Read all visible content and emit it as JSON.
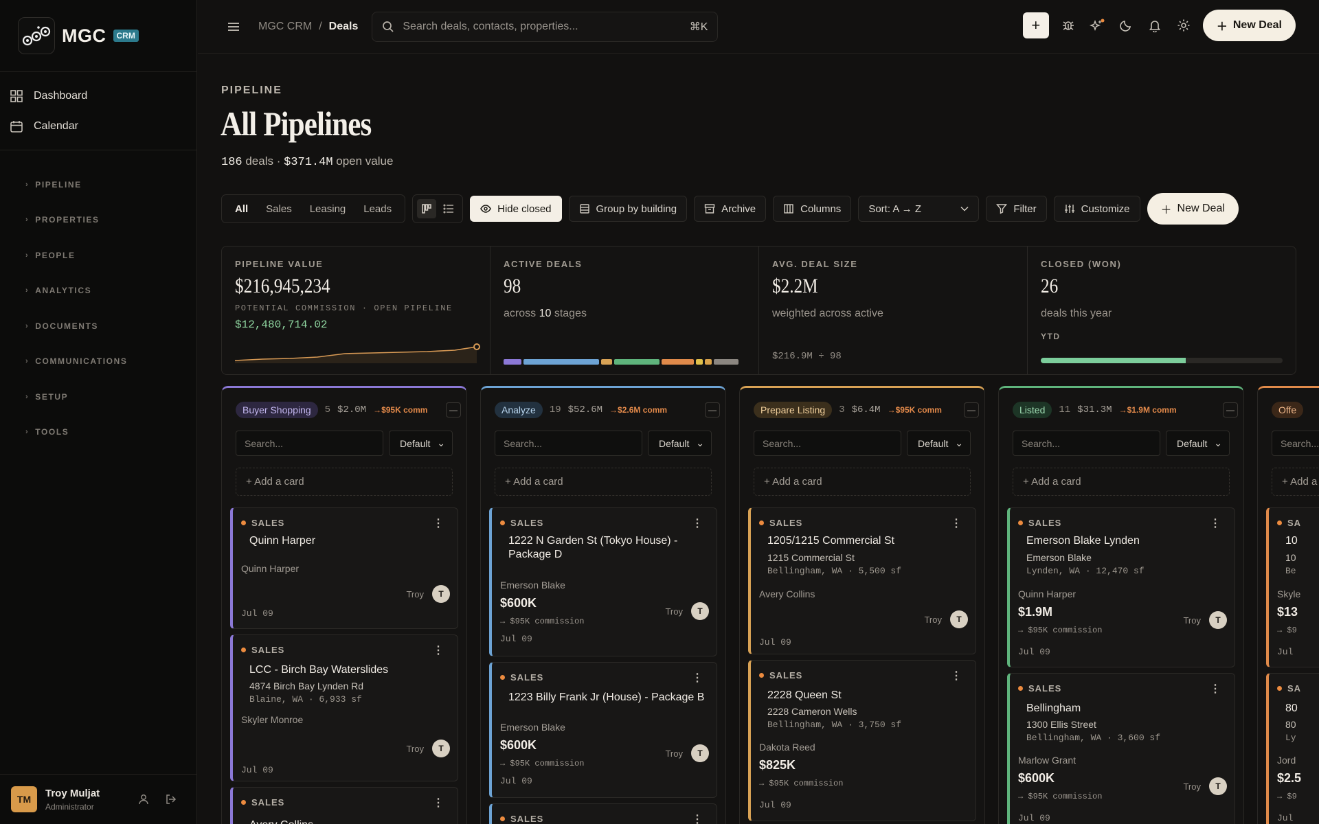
{
  "brand": {
    "name": "MGC",
    "badge": "CRM"
  },
  "sidebar": {
    "main": [
      {
        "label": "Dashboard",
        "icon": "grid-icon"
      },
      {
        "label": "Calendar",
        "icon": "calendar-icon"
      }
    ],
    "sections": [
      "PIPELINE",
      "PROPERTIES",
      "PEOPLE",
      "ANALYTICS",
      "DOCUMENTS",
      "COMMUNICATIONS",
      "SETUP",
      "TOOLS"
    ]
  },
  "user": {
    "initials": "TM",
    "name": "Troy Muljat",
    "role": "Administrator"
  },
  "topbar": {
    "breadcrumb": [
      "MGC CRM",
      "/",
      "Deals"
    ],
    "search_placeholder": "Search deals, contacts, properties...",
    "shortcut": "⌘K",
    "new_deal": "New Deal"
  },
  "page": {
    "kicker": "PIPELINE",
    "title": "All Pipelines",
    "deals_count": "186",
    "deals_label": "deals ·",
    "open_value": "$371.4M",
    "open_label": "open value"
  },
  "toolbar": {
    "tabs": [
      "All",
      "Sales",
      "Leasing",
      "Leads"
    ],
    "hide_closed": "Hide closed",
    "group_by": "Group by building",
    "archive": "Archive",
    "columns": "Columns",
    "sort": "Sort: A → Z",
    "filter": "Filter",
    "customize": "Customize",
    "new_deal": "New Deal"
  },
  "stats": {
    "pipeline": {
      "label": "PIPELINE VALUE",
      "value": "$216,945,234",
      "commission_label": "POTENTIAL COMMISSION · OPEN PIPELINE",
      "commission": "$12,480,714.02"
    },
    "active": {
      "label": "ACTIVE DEALS",
      "value": "98",
      "sub_prefix": "across",
      "stages": "10",
      "sub_suffix": "stages",
      "stage_colors": [
        "#8b78d6",
        "#6da3d4",
        "#d8a255",
        "#5fb47c",
        "#e08a4a",
        "#e0c04a",
        "#d9a24a",
        "#8b8680"
      ],
      "stage_share": [
        0.08,
        0.33,
        0.05,
        0.2,
        0.14,
        0.03,
        0.03,
        0.11
      ]
    },
    "avg": {
      "label": "AVG. DEAL SIZE",
      "value": "$2.2M",
      "sub": "weighted across active",
      "calc": "$216.9M ÷ 98"
    },
    "closed": {
      "label": "CLOSED (WON)",
      "value": "26",
      "sub": "deals this year",
      "ytd_label": "YTD",
      "ytd_fraction": 0.6
    }
  },
  "colors": {
    "accent": "#f5efe3",
    "commission": "#e2894a",
    "positive": "#8fd6a0"
  },
  "columns": [
    {
      "stage": "Buyer Shopping",
      "count": "5",
      "amount": "$2.0M",
      "comm": "→$95K comm",
      "color": "#8b78d6",
      "pill_bg": "#2d2740",
      "pill_fg": "#c4b8f0"
    },
    {
      "stage": "Analyze",
      "count": "19",
      "amount": "$52.6M",
      "comm": "→$2.6M comm",
      "color": "#6da3d4",
      "pill_bg": "#22313f",
      "pill_fg": "#b9d6ef"
    },
    {
      "stage": "Prepare Listing",
      "count": "3",
      "amount": "$6.4M",
      "comm": "→$95K comm",
      "color": "#d8a255",
      "pill_bg": "#3b2f1c",
      "pill_fg": "#f0cf9c"
    },
    {
      "stage": "Listed",
      "count": "11",
      "amount": "$31.3M",
      "comm": "→$1.9M comm",
      "color": "#5fb47c",
      "pill_bg": "#1d3526",
      "pill_fg": "#9fdcb3"
    },
    {
      "stage": "Offe",
      "count": "",
      "amount": "",
      "comm": "",
      "color": "#e08a4a",
      "pill_bg": "#3b2718",
      "pill_fg": "#efb78a"
    }
  ],
  "column_ui": {
    "search_placeholder": "Search...",
    "sort_default": "Default",
    "add_card": "+ Add a card",
    "collapse": "—"
  },
  "cards": {
    "c0": [
      {
        "kind": "SALES",
        "name": "Quinn Harper",
        "contact": "Quinn Harper",
        "owner": "Troy",
        "owner_initial": "T",
        "date": "Jul 09"
      },
      {
        "kind": "SALES",
        "name": "LCC - Birch Bay Waterslides",
        "addr": "4874 Birch Bay Lynden Rd",
        "loc": "Blaine, WA · 6,933 sf",
        "contact": "Skyler Monroe",
        "owner": "Troy",
        "owner_initial": "T",
        "date": "Jul 09"
      },
      {
        "kind": "SALES",
        "name": "Avery Collins"
      }
    ],
    "c1": [
      {
        "kind": "SALES",
        "name": "1222 N Garden St (Tokyo House) - Package D",
        "contact": "Emerson Blake",
        "value": "$600K",
        "comm": "→ $95K commission",
        "owner": "Troy",
        "owner_initial": "T",
        "date": "Jul 09"
      },
      {
        "kind": "SALES",
        "name": "1223 Billy Frank Jr (House) - Package B",
        "contact": "Emerson Blake",
        "value": "$600K",
        "comm": "→ $95K commission",
        "owner": "Troy",
        "owner_initial": "T",
        "date": "Jul 09"
      },
      {
        "kind": "SALES"
      }
    ],
    "c2": [
      {
        "kind": "SALES",
        "name": "1205/1215 Commercial St",
        "addr": "1215 Commercial St",
        "loc": "Bellingham, WA · 5,500 sf",
        "contact": "Avery Collins",
        "owner": "Troy",
        "owner_initial": "T",
        "date": "Jul 09"
      },
      {
        "kind": "SALES",
        "name": "2228 Queen St",
        "addr": "2228 Cameron Wells",
        "loc": "Bellingham, WA · 3,750 sf",
        "contact": "Dakota Reed",
        "value": "$825K",
        "comm": "→ $95K commission",
        "date": "Jul 09"
      }
    ],
    "c3": [
      {
        "kind": "SALES",
        "name": "Emerson Blake Lynden",
        "addr": "Emerson Blake",
        "loc": "Lynden, WA · 12,470 sf",
        "contact": "Quinn Harper",
        "value": "$1.9M",
        "comm": "→ $95K commission",
        "owner": "Troy",
        "owner_initial": "T",
        "date": "Jul 09"
      },
      {
        "kind": "SALES",
        "name": "Bellingham",
        "addr": "1300 Ellis Street",
        "loc": "Bellingham, WA · 3,600 sf",
        "contact": "Marlow Grant",
        "value": "$600K",
        "comm": "→ $95K commission",
        "owner": "Troy",
        "owner_initial": "T",
        "date": "Jul 09"
      }
    ],
    "c4": [
      {
        "kind": "SA",
        "name": "10",
        "addr": "10",
        "loc": "Be",
        "contact": "Skyle",
        "value": "$13",
        "comm": "→ $9",
        "date": "Jul"
      },
      {
        "kind": "SA",
        "name": "80",
        "addr": "80",
        "loc": "Ly",
        "contact": "Jord",
        "value": "$2.5",
        "comm": "→ $9",
        "date": "Jul"
      }
    ]
  }
}
